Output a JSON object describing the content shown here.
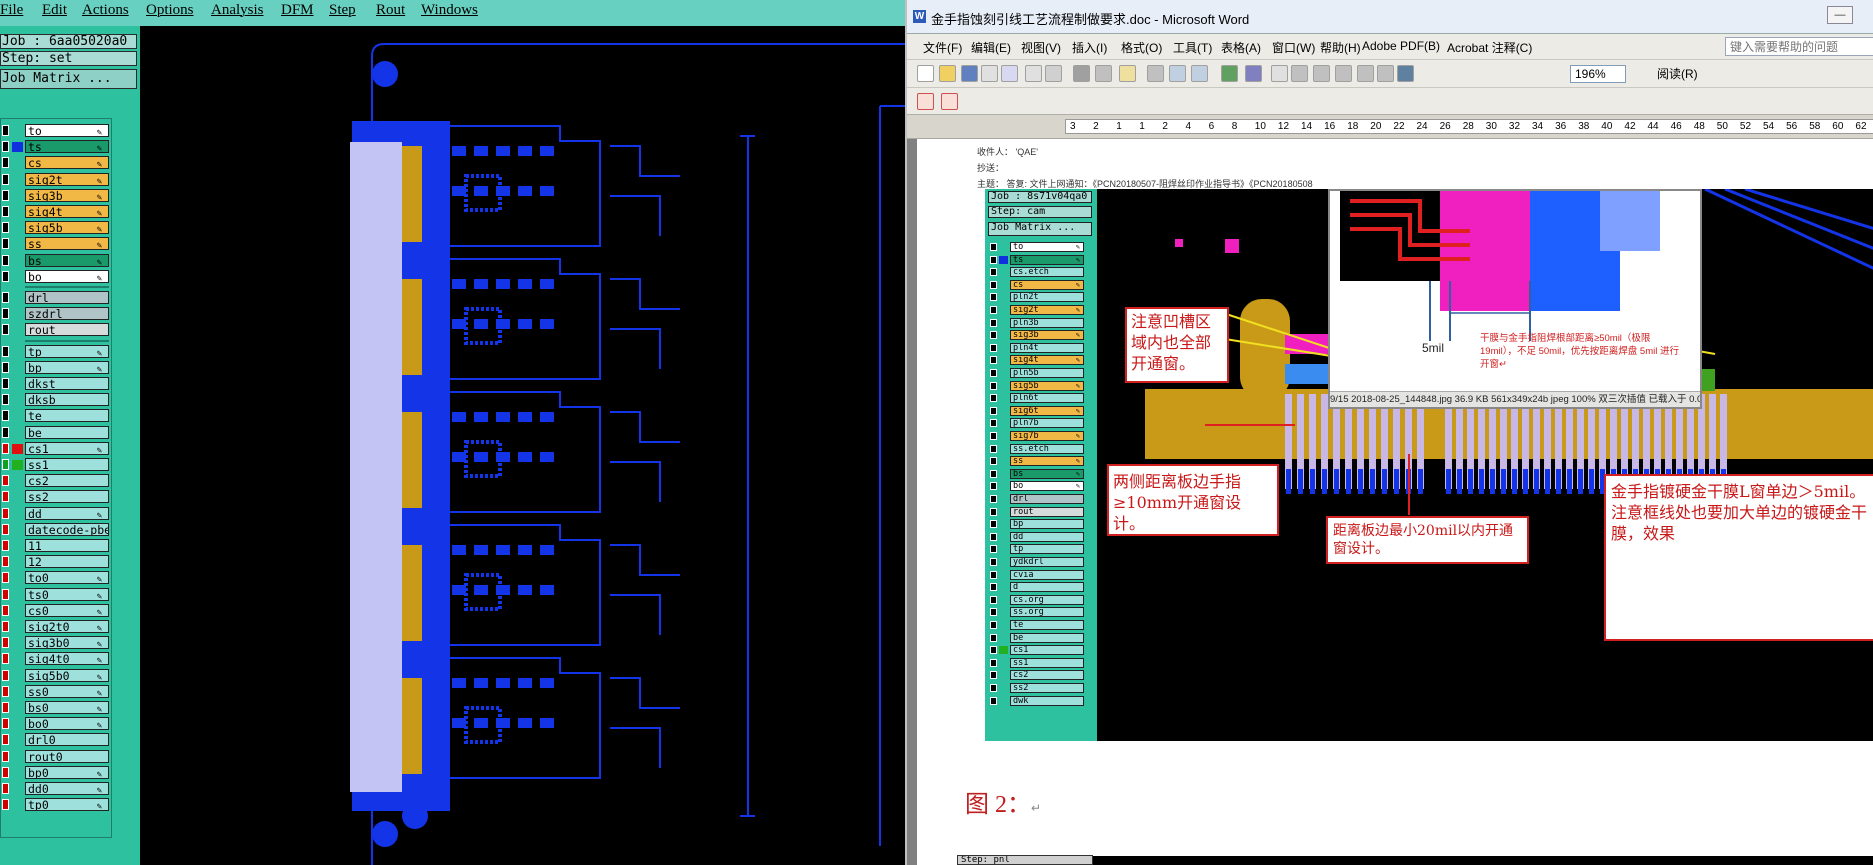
{
  "cam": {
    "menu": [
      "File",
      "Edit",
      "Actions",
      "Options",
      "Analysis",
      "DFM",
      "Step",
      "Rout",
      "Windows"
    ],
    "job": "Job : 6aa05020a0",
    "step": "Step: set",
    "matrix_button": "Job Matrix ...",
    "layers": [
      {
        "name": "to",
        "color": "white",
        "box": "black",
        "pen": true
      },
      {
        "name": "ts",
        "color": "green",
        "box": "black",
        "swatch": "#1030e0",
        "pen": true
      },
      {
        "name": "cs",
        "color": "orange",
        "box": "black",
        "pen": true
      },
      {
        "name": "sig2t",
        "color": "orange",
        "box": "black",
        "pen": true
      },
      {
        "name": "sig3b",
        "color": "orange",
        "box": "black",
        "pen": true
      },
      {
        "name": "sig4t",
        "color": "orange",
        "box": "black",
        "pen": true
      },
      {
        "name": "sig5b",
        "color": "orange",
        "box": "black",
        "pen": true
      },
      {
        "name": "ss",
        "color": "orange",
        "box": "black",
        "pen": true
      },
      {
        "name": "bs",
        "color": "green",
        "box": "black",
        "pen": true
      },
      {
        "name": "bo",
        "color": "white",
        "box": "black",
        "pen": true
      },
      {
        "name": "drl",
        "color": "grey",
        "box": "black",
        "gap": true
      },
      {
        "name": "szdrl",
        "color": "grey",
        "box": "black"
      },
      {
        "name": "rout",
        "color": "ltgrey",
        "box": "black"
      },
      {
        "name": "tp",
        "color": "cyan",
        "box": "black",
        "pen": true,
        "gap": true
      },
      {
        "name": "bp",
        "color": "cyan",
        "box": "black",
        "pen": true
      },
      {
        "name": "dkst",
        "color": "cyan",
        "box": "black"
      },
      {
        "name": "dksb",
        "color": "cyan",
        "box": "black"
      },
      {
        "name": "te",
        "color": "cyan",
        "box": "black"
      },
      {
        "name": "be",
        "color": "cyan",
        "box": "black"
      },
      {
        "name": "cs1",
        "color": "cyan",
        "box": "red",
        "swatch": "#e01010",
        "pen": true
      },
      {
        "name": "ss1",
        "color": "cyan",
        "box": "green",
        "swatch": "#20b020"
      },
      {
        "name": "cs2",
        "color": "cyan",
        "box": "red"
      },
      {
        "name": "ss2",
        "color": "cyan",
        "box": "red"
      },
      {
        "name": "dd",
        "color": "cyan",
        "box": "red",
        "pen": true
      },
      {
        "name": "datecode-pbe",
        "color": "cyan",
        "box": "red"
      },
      {
        "name": "11",
        "color": "cyan",
        "box": "red"
      },
      {
        "name": "12",
        "color": "cyan",
        "box": "red"
      },
      {
        "name": "to0",
        "color": "cyan",
        "box": "red",
        "pen": true
      },
      {
        "name": "ts0",
        "color": "cyan",
        "box": "red",
        "pen": true
      },
      {
        "name": "cs0",
        "color": "cyan",
        "box": "red",
        "pen": true
      },
      {
        "name": "sig2t0",
        "color": "cyan",
        "box": "red",
        "pen": true
      },
      {
        "name": "sig3b0",
        "color": "cyan",
        "box": "red",
        "pen": true
      },
      {
        "name": "sig4t0",
        "color": "cyan",
        "box": "red",
        "pen": true
      },
      {
        "name": "sig5b0",
        "color": "cyan",
        "box": "red",
        "pen": true
      },
      {
        "name": "ss0",
        "color": "cyan",
        "box": "red",
        "pen": true
      },
      {
        "name": "bs0",
        "color": "cyan",
        "box": "red",
        "pen": true
      },
      {
        "name": "bo0",
        "color": "cyan",
        "box": "red",
        "pen": true
      },
      {
        "name": "drl0",
        "color": "cyan",
        "box": "red"
      },
      {
        "name": "rout0",
        "color": "cyan",
        "box": "red"
      },
      {
        "name": "bp0",
        "color": "cyan",
        "box": "red",
        "pen": true
      },
      {
        "name": "dd0",
        "color": "cyan",
        "box": "red",
        "pen": true
      },
      {
        "name": "tp0",
        "color": "cyan",
        "box": "red",
        "pen": true
      }
    ]
  },
  "word": {
    "title": "金手指蚀刻引线工艺流程制做要求.doc - Microsoft Word",
    "menu": [
      "文件(F)",
      "编辑(E)",
      "视图(V)",
      "插入(I)",
      "格式(O)",
      "工具(T)",
      "表格(A)",
      "窗口(W)",
      "帮助(H)",
      "Adobe PDF(B)",
      "Acrobat 注释(C)"
    ],
    "help_placeholder": "键入需要帮助的问题",
    "zoom": "196%",
    "read_label": "阅读(R)",
    "ruler_numbers": [
      "3",
      "2",
      "1",
      "1",
      "2",
      "4",
      "6",
      "8",
      "10",
      "12",
      "14",
      "16",
      "18",
      "20",
      "22",
      "24",
      "26",
      "28",
      "30",
      "32",
      "34",
      "36",
      "38",
      "40",
      "42",
      "44",
      "46",
      "48",
      "50",
      "52",
      "54",
      "56",
      "58",
      "60",
      "62"
    ],
    "email": {
      "to": "收件人：  'QAE'",
      "cc": "抄送：",
      "subject": "主题：     答复: 文件上网通知：《PCN20180507-阻焊丝印作业指导书》《PCN20180508"
    },
    "embedded": {
      "job": "Job : 8s71v04qa0",
      "step": "Step: cam",
      "matrix_button": "Job Matrix ...",
      "layers": [
        {
          "name": "to",
          "color": "white",
          "pen": true
        },
        {
          "name": "ts",
          "color": "green",
          "swatch": "#1030e0",
          "pen": true
        },
        {
          "name": "cs.etch",
          "color": "cyan"
        },
        {
          "name": "cs",
          "color": "orange",
          "pen": true
        },
        {
          "name": "pln2t",
          "color": "cyan"
        },
        {
          "name": "sig2t",
          "color": "orange",
          "pen": true
        },
        {
          "name": "pln3b",
          "color": "cyan"
        },
        {
          "name": "sig3b",
          "color": "orange",
          "pen": true
        },
        {
          "name": "pln4t",
          "color": "cyan"
        },
        {
          "name": "sig4t",
          "color": "orange",
          "pen": true
        },
        {
          "name": "pln5b",
          "color": "cyan"
        },
        {
          "name": "sig5b",
          "color": "orange",
          "pen": true
        },
        {
          "name": "pln6t",
          "color": "cyan"
        },
        {
          "name": "sig6t",
          "color": "orange",
          "pen": true
        },
        {
          "name": "pln7b",
          "color": "cyan"
        },
        {
          "name": "sig7b",
          "color": "orange",
          "pen": true
        },
        {
          "name": "ss.etch",
          "color": "cyan"
        },
        {
          "name": "ss",
          "color": "orange",
          "pen": true
        },
        {
          "name": "bs",
          "color": "green",
          "pen": true
        },
        {
          "name": "bo",
          "color": "white",
          "pen": true
        },
        {
          "name": "drl",
          "color": "grey"
        },
        {
          "name": "rout",
          "color": "ltgrey"
        },
        {
          "name": "bp",
          "color": "cyan"
        },
        {
          "name": "dd",
          "color": "cyan"
        },
        {
          "name": "tp",
          "color": "cyan"
        },
        {
          "name": "ydkdrl",
          "color": "cyan"
        },
        {
          "name": "cvia",
          "color": "cyan"
        },
        {
          "name": "d",
          "color": "cyan"
        },
        {
          "name": "cs.org",
          "color": "cyan"
        },
        {
          "name": "ss.org",
          "color": "cyan"
        },
        {
          "name": "te",
          "color": "cyan"
        },
        {
          "name": "be",
          "color": "cyan"
        },
        {
          "name": "cs1",
          "color": "cyan",
          "swatch": "#20b020"
        },
        {
          "name": "ss1",
          "color": "cyan"
        },
        {
          "name": "cs2",
          "color": "cyan"
        },
        {
          "name": "ss2",
          "color": "cyan"
        },
        {
          "name": "dwk",
          "color": "cyan"
        }
      ],
      "viewer_note": "干膜与金手指阻焊根部距离≥50mil（极限 19mil），不足 50mil，优先按距离焊盘 5mil 进行开窗↵",
      "viewer_dim": "5mil",
      "viewer_status": "9/15   2018-08-25_144848.jpg   36.9 KB   561x349x24b jpeg   100%   双三次插值   已载入于 0.0 秒",
      "annotations": {
        "groove": "注意凹槽区域内也全部开通窗。",
        "edge": "两侧距离板边手指≥10mm开通窗设计。",
        "min_dist": "距离板边最小20mil以内开通窗设计。",
        "plating": "金手指镀硬金干膜L窗单边＞5mil。注意框线处也要加大单边的镀硬金干膜，效果"
      }
    },
    "caption": "图 2：",
    "caption_mark": "↵",
    "bottom_label": "Step: pnl"
  }
}
